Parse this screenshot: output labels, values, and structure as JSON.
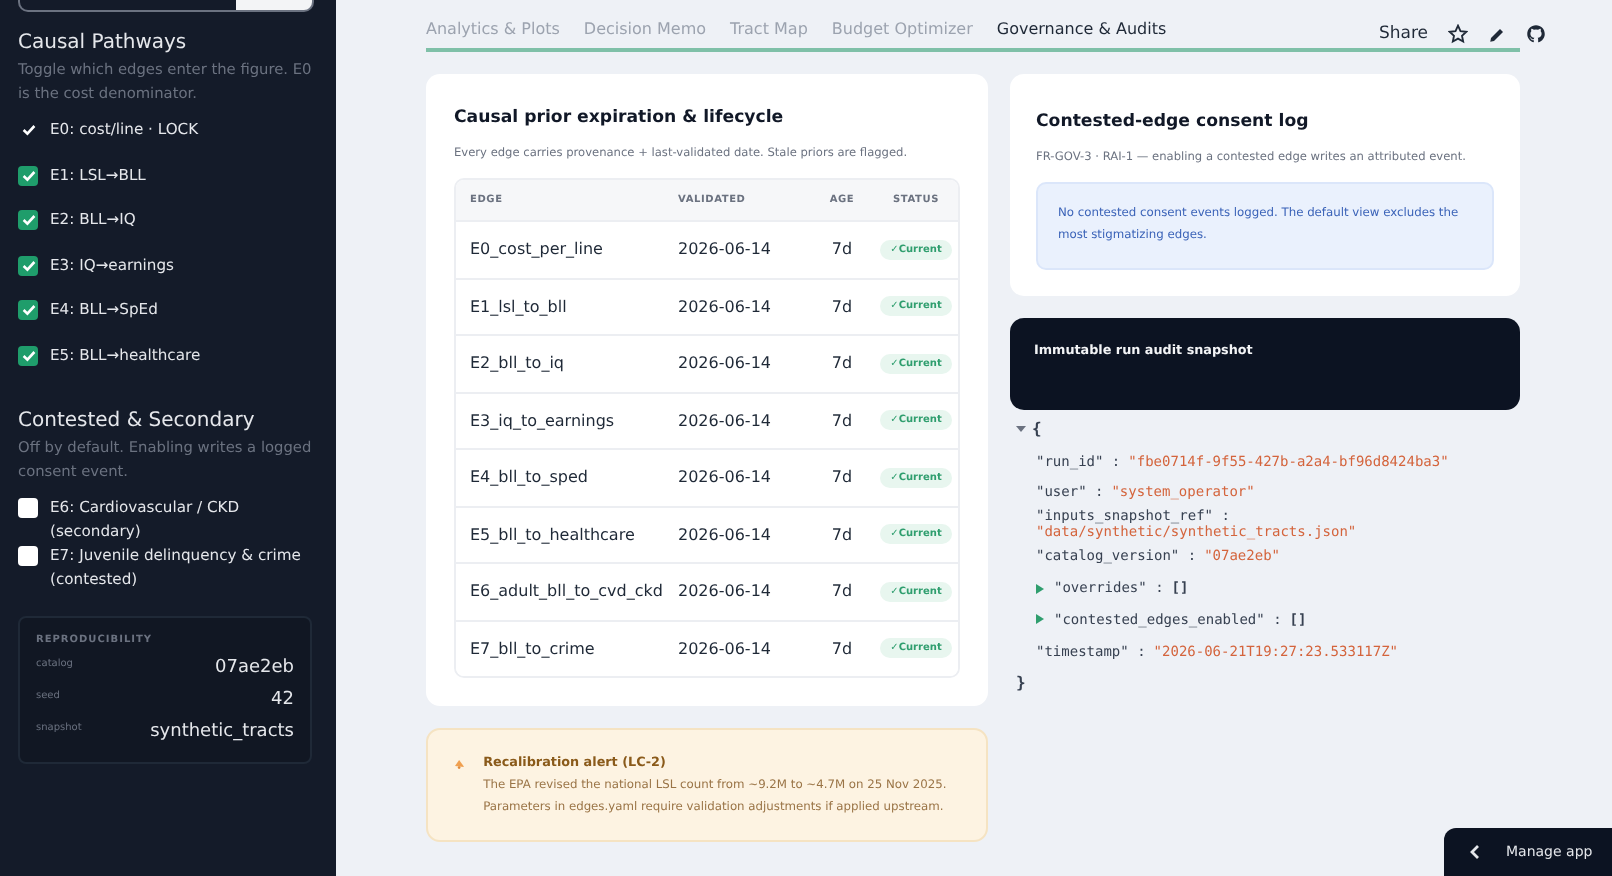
{
  "sidebar": {
    "top_field": {
      "kind": "field"
    },
    "sections": [
      {
        "title": "Causal Pathways",
        "caption": "Toggle which edges enter the figure. E0 is the cost denominator.",
        "items": [
          {
            "label": "E0: cost/line · LOCK",
            "checked": true,
            "disabled": true
          },
          {
            "label": "E1: LSL→BLL",
            "checked": true,
            "disabled": false
          },
          {
            "label": "E2: BLL→IQ",
            "checked": true,
            "disabled": false
          },
          {
            "label": "E3: IQ→earnings",
            "checked": true,
            "disabled": false
          },
          {
            "label": "E4: BLL→SpEd",
            "checked": true,
            "disabled": false
          },
          {
            "label": "E5: BLL→healthcare",
            "checked": true,
            "disabled": false
          }
        ]
      },
      {
        "title": "Contested & Secondary",
        "caption": "Off by default. Enabling writes a logged consent event.",
        "items": [
          {
            "label": "E6: Cardiovascular / CKD (secondary)",
            "checked": false,
            "disabled": false
          },
          {
            "label": "E7: Juvenile delinquency & crime (contested)",
            "checked": false,
            "disabled": false
          }
        ]
      }
    ],
    "reproducibility": {
      "title": "REPRODUCIBILITY",
      "rows": [
        {
          "key": "catalog",
          "value": "07ae2eb"
        },
        {
          "key": "seed",
          "value": "42"
        },
        {
          "key": "snapshot",
          "value": "synthetic_tracts"
        }
      ]
    }
  },
  "tabs": [
    {
      "label": "Analytics & Plots",
      "selected": false
    },
    {
      "label": "Decision Memo",
      "selected": false
    },
    {
      "label": "Tract Map",
      "selected": false
    },
    {
      "label": "Budget Optimizer",
      "selected": false
    },
    {
      "label": "Governance & Audits",
      "selected": true
    }
  ],
  "header": {
    "share": "Share"
  },
  "lifecycle": {
    "title": "Causal prior expiration & lifecycle",
    "caption": "Every edge carries provenance + last-validated date. Stale priors are flagged.",
    "columns": [
      "EDGE",
      "VALIDATED",
      "AGE",
      "STATUS"
    ],
    "rows": [
      {
        "edge": "E0_cost_per_line",
        "validated": "2026-06-14",
        "age": "7d",
        "status": "✓Current",
        "stale": false
      },
      {
        "edge": "E1_lsl_to_bll",
        "validated": "2026-06-14",
        "age": "7d",
        "status": "✓Current",
        "stale": false
      },
      {
        "edge": "E2_bll_to_iq",
        "validated": "2026-06-14",
        "age": "7d",
        "status": "✓Current",
        "stale": false
      },
      {
        "edge": "E3_iq_to_earnings",
        "validated": "2026-06-14",
        "age": "7d",
        "status": "✓Current",
        "stale": false
      },
      {
        "edge": "E4_bll_to_sped",
        "validated": "2026-06-14",
        "age": "7d",
        "status": "✓Current",
        "stale": false
      },
      {
        "edge": "E5_bll_to_healthcare",
        "validated": "2026-06-14",
        "age": "7d",
        "status": "✓Current",
        "stale": false
      },
      {
        "edge": "E6_adult_bll_to_cvd_ckd",
        "validated": "2026-06-14",
        "age": "7d",
        "status": "✓Current",
        "stale": false
      },
      {
        "edge": "E7_bll_to_crime",
        "validated": "2026-06-14",
        "age": "7d",
        "status": "✓Current",
        "stale": false
      }
    ]
  },
  "alert": {
    "title": "Recalibration alert (LC-2)",
    "text": "The EPA revised the national LSL count from ~9.2M to ~4.7M on 25 Nov 2025. Parameters in edges.yaml require validation adjustments if applied upstream."
  },
  "consent_log": {
    "title": "Contested-edge consent log",
    "caption": "FR-GOV-3 · RAI-1 — enabling a contested edge writes an attributed event.",
    "info": "No contested consent events logged. The default view excludes the most stigmatizing edges."
  },
  "snapshot": {
    "title": "Immutable run audit snapshot",
    "expanded": true,
    "open": "{",
    "close": "}",
    "entries": [
      {
        "kind": "value",
        "key": "\"run_id\" :",
        "value": "\"fbe0714f-9f55-427b-a2a4-bf96d8424ba3\""
      },
      {
        "kind": "value",
        "key": "\"user\" :",
        "value": "\"system_operator\""
      },
      {
        "kind": "value",
        "key": "\"inputs_snapshot_ref\" :",
        "value": "\"data/synthetic/synthetic_tracts.json\""
      },
      {
        "kind": "value",
        "key": "\"catalog_version\" :",
        "value": "\"07ae2eb\""
      },
      {
        "kind": "collapsed",
        "key": "\"overrides\" :",
        "value": "[]"
      },
      {
        "kind": "collapsed",
        "key": "\"contested_edges_enabled\" :",
        "value": "[]"
      },
      {
        "kind": "value",
        "key": "\"timestamp\" :",
        "value": "\"2026-06-21T19:27:23.533117Z\""
      }
    ]
  },
  "manage": {
    "label": "Manage app"
  }
}
